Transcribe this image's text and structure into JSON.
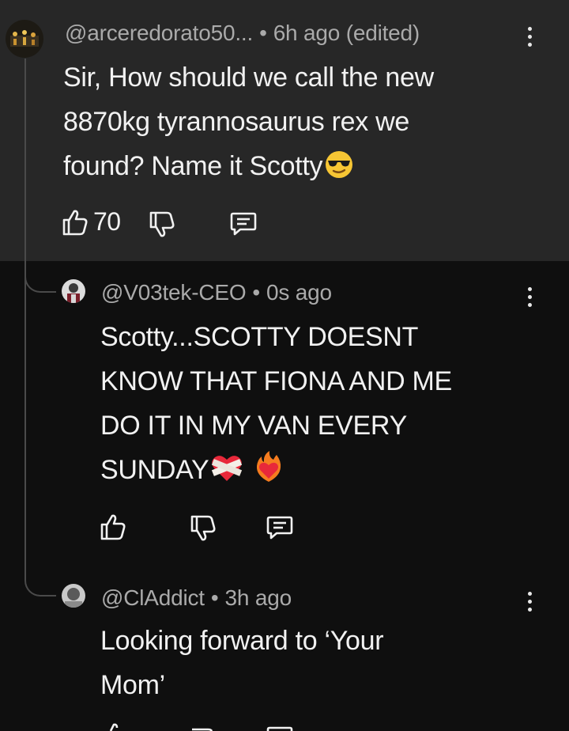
{
  "comments": [
    {
      "handle": "@arceredorato50...",
      "time": "6h ago (edited)",
      "text_lines": [
        "Sir, How should we call the new",
        "8870kg tyrannosaurus rex we",
        "found? Name it Scotty"
      ],
      "emoji": "smiling-face-with-sunglasses",
      "likes": "70"
    },
    {
      "handle": "@V03tek-CEO",
      "time": "0s ago",
      "text_lines": [
        "Scotty...SCOTTY DOESNT",
        "KNOW THAT FIONA AND ME",
        "DO IT IN MY VAN EVERY",
        "SUNDAY"
      ],
      "emojis": [
        "bandaged-heart",
        "heart-on-fire"
      ]
    },
    {
      "handle": "@ClAddict",
      "time": "3h ago",
      "text_lines": [
        "Looking forward to ‘Your",
        "Mom’"
      ]
    }
  ],
  "separator": "•",
  "colors": {
    "top_bg": "#272727",
    "page_bg": "#0f0f0f",
    "meta": "#aaaaaa",
    "text": "#f1f1f1"
  }
}
